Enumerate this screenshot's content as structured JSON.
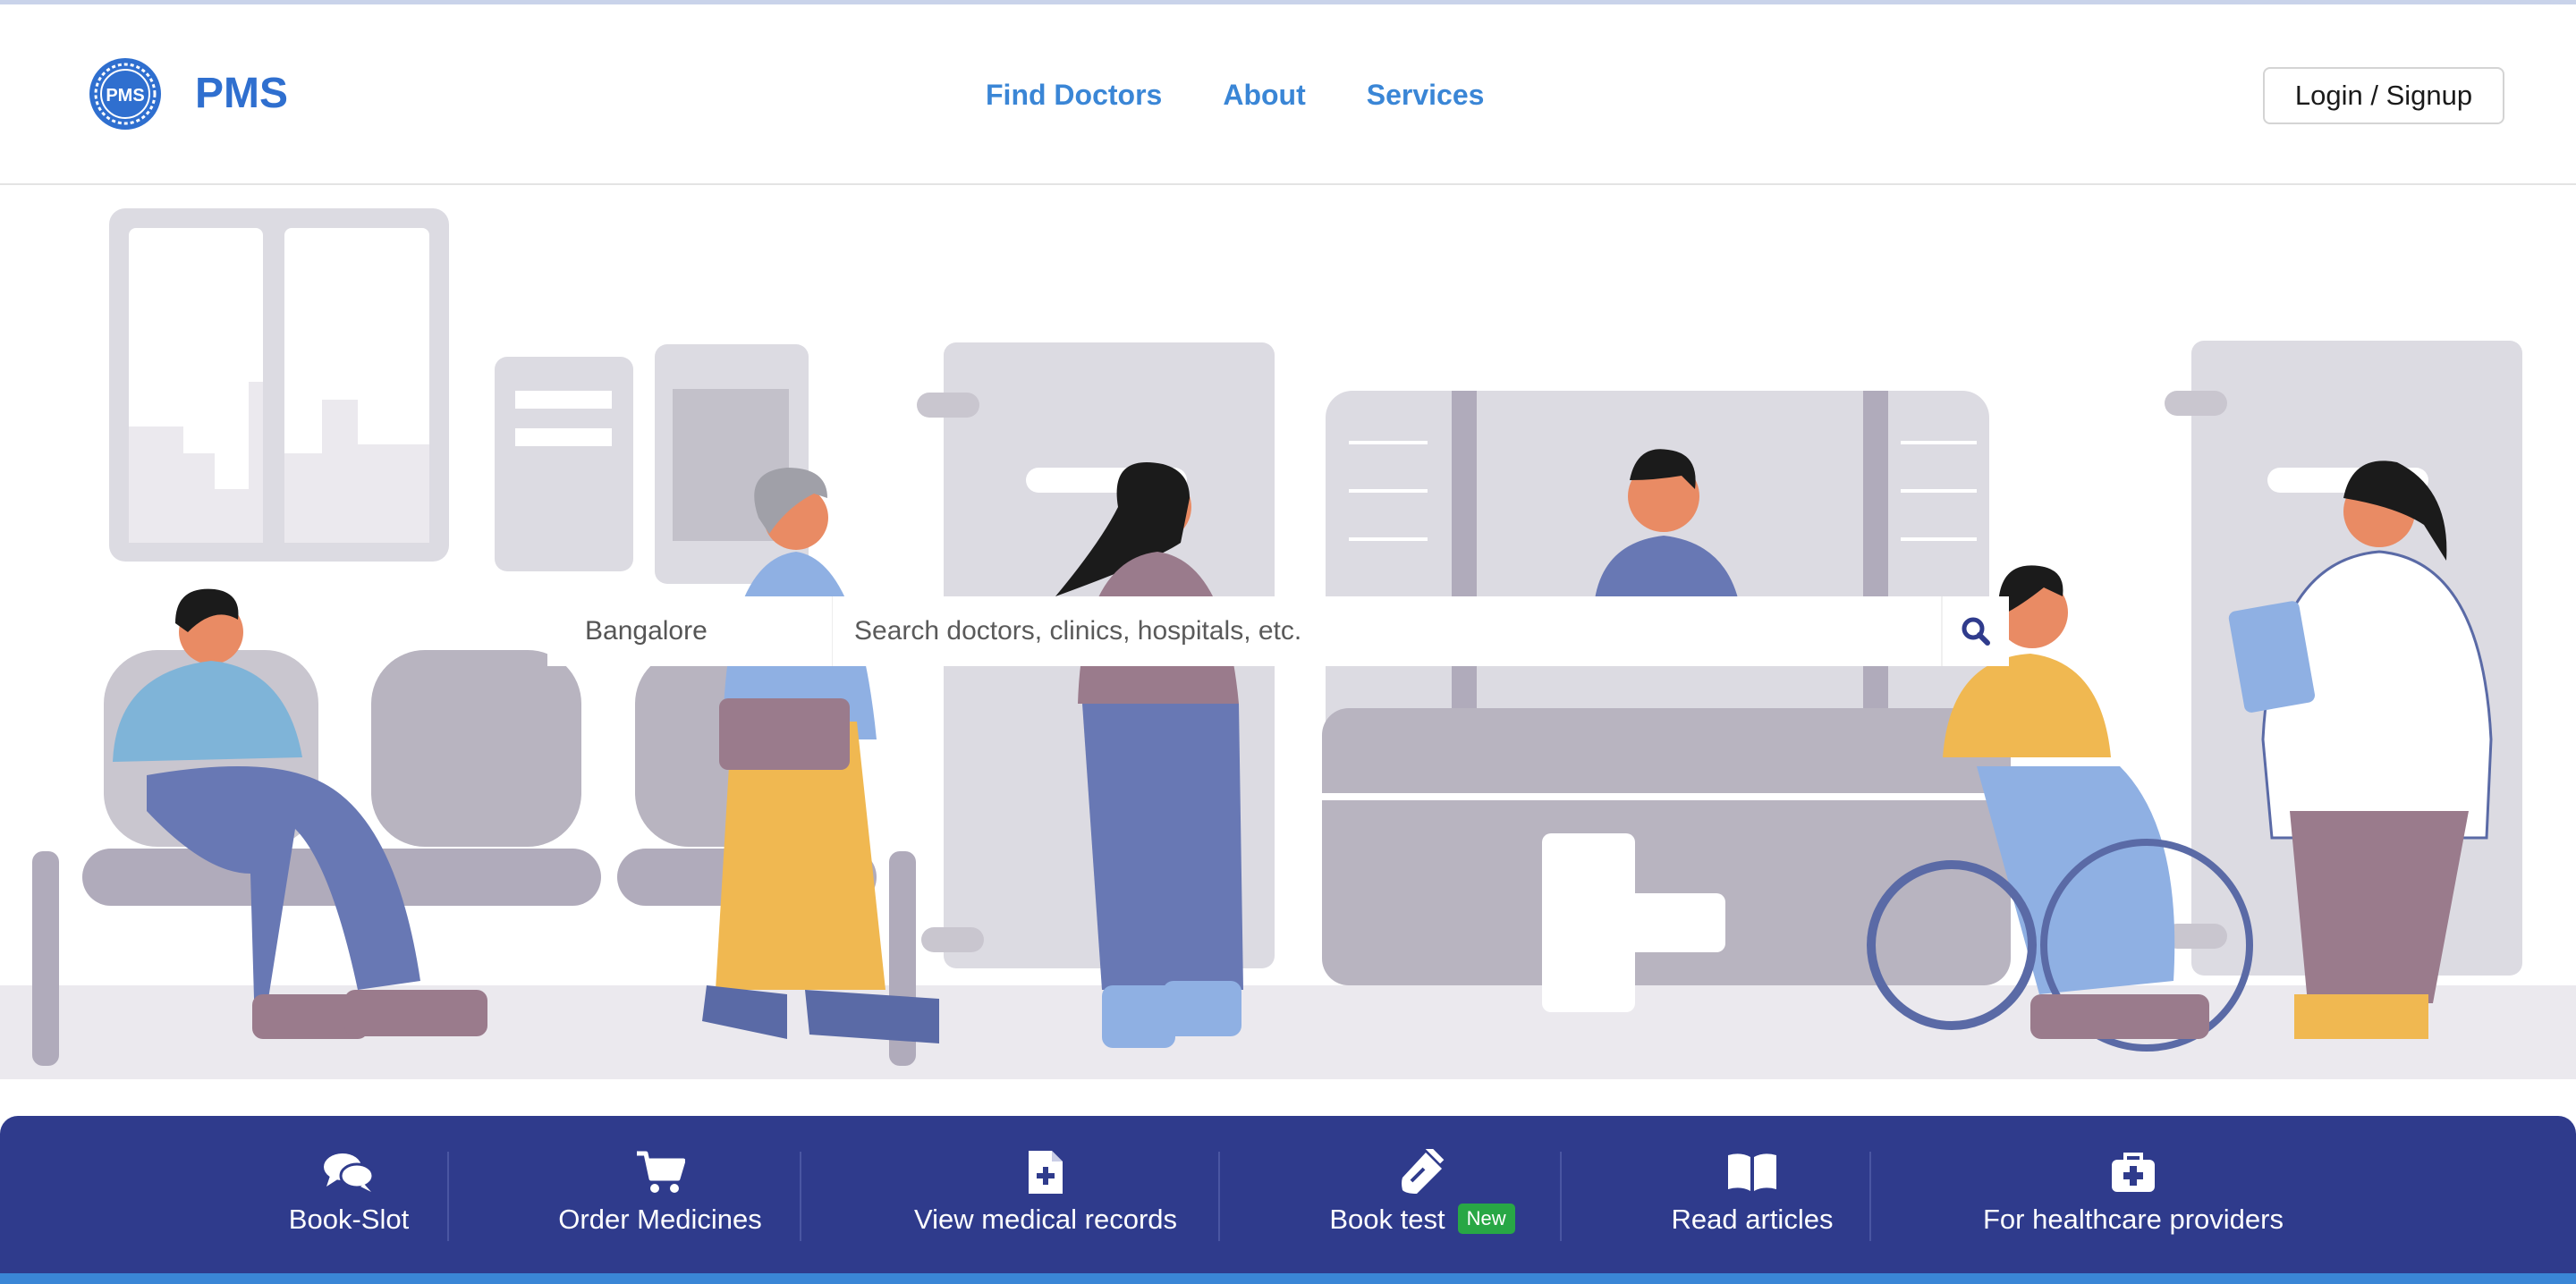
{
  "header": {
    "brand": "PMS",
    "logo_text": "PMS",
    "nav": [
      "Find Doctors",
      "About",
      "Services"
    ],
    "login_label": "Login / Signup"
  },
  "search": {
    "location_value": "Bangalore",
    "query_placeholder": "Search doctors, clinics, hospitals, etc."
  },
  "actions": [
    {
      "label": "Book-Slot",
      "icon": "chat-bubbles-icon"
    },
    {
      "label": "Order Medicines",
      "icon": "cart-icon"
    },
    {
      "label": "View medical records",
      "icon": "file-plus-icon"
    },
    {
      "label": "Book test",
      "icon": "test-tube-icon",
      "badge": "New"
    },
    {
      "label": "Read articles",
      "icon": "open-book-icon"
    },
    {
      "label": "For healthcare providers",
      "icon": "medical-kit-icon"
    }
  ],
  "colors": {
    "brand": "#2f6fcf",
    "nav": "#3a86d6",
    "bar": "#2f3b8c",
    "badge": "#28a745"
  }
}
